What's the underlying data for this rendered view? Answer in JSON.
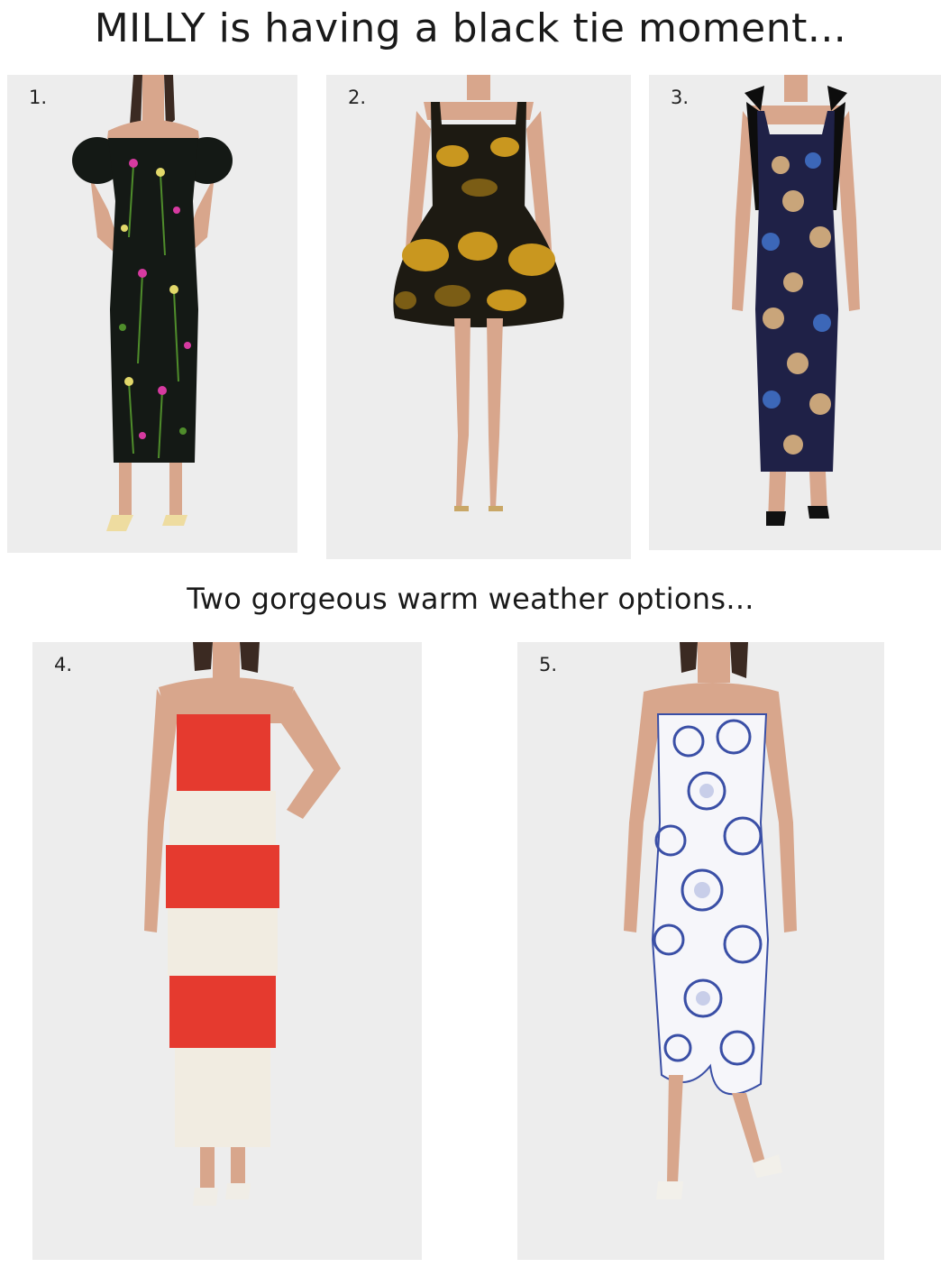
{
  "title": "MILLY is having a black tie moment...",
  "subtitle": "Two gorgeous warm weather options...",
  "looks": [
    {
      "number": "1.",
      "description": "off-shoulder puff-sleeve black floral embroidered midi dress",
      "colors": {
        "fabric": "#141915",
        "accent1": "#4f8d2b",
        "accent2": "#d63aa0",
        "accent3": "#e2d86a",
        "shoes": "#eedca0"
      }
    },
    {
      "number": "2.",
      "description": "black and gold floral jacquard mini dress",
      "colors": {
        "fabric": "#1d1a12",
        "accent1": "#c9971f",
        "accent2": "#7b5d15",
        "shoes": "#c9a767"
      }
    },
    {
      "number": "3.",
      "description": "navy sequin floral column gown with black bow straps",
      "colors": {
        "fabric": "#1f2147",
        "accent1": "#c9a57a",
        "accent2": "#3c67b8",
        "bows": "#0d0d0d",
        "shoes": "#111111"
      }
    },
    {
      "number": "4.",
      "description": "strapless red and white striped column gown",
      "colors": {
        "stripe_a": "#e53a2f",
        "stripe_b": "#f1ece1",
        "shoes": "#f0ede6"
      }
    },
    {
      "number": "5.",
      "description": "strapless white and blue floral lace midi dress",
      "colors": {
        "fabric": "#f6f6fa",
        "accent1": "#3a4fa6",
        "accent2": "#9aa6d8",
        "shoes": "#f2f0ea"
      }
    }
  ],
  "colors": {
    "background": "#ffffff",
    "card": "#ededed",
    "skin": "#d8a68c",
    "hair": "#3b2a22",
    "text": "#1a1a1a"
  }
}
